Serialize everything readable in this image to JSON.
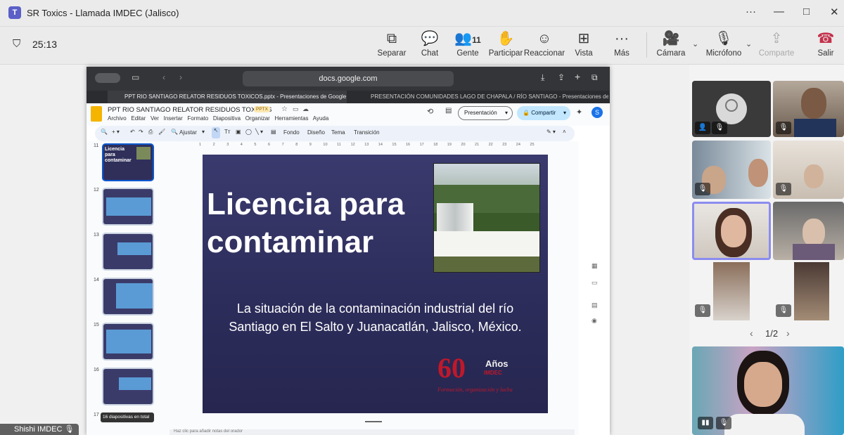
{
  "window": {
    "title": "SR Toxics - Llamada IMDEC (Jalisco)",
    "minimize": "—",
    "maximize": "□",
    "close": "✕",
    "more": "···"
  },
  "meeting": {
    "timer": "25:13"
  },
  "toolbar": [
    {
      "label": "Separar",
      "icon": "⧉"
    },
    {
      "label": "Chat",
      "icon": "💬"
    },
    {
      "label": "Gente",
      "icon": "👥",
      "badge": "11"
    },
    {
      "label": "Participar",
      "icon": "✋"
    },
    {
      "label": "Reaccionar",
      "icon": "☺"
    },
    {
      "label": "Vista",
      "icon": "⊞"
    },
    {
      "label": "Más",
      "icon": "···"
    },
    {
      "label": "Cámara",
      "icon": "🎥"
    },
    {
      "label": "Micrófono",
      "icon": "🎙"
    },
    {
      "label": "Comparte",
      "icon": "⇪"
    },
    {
      "label": "Salir",
      "icon": "☎"
    }
  ],
  "browser": {
    "url": "docs.google.com",
    "tabs": [
      "PPT RIO SANTIAGO RELATOR RESIDUOS TOXICOS.pptx - Presentaciones de Google",
      "PRESENTACIÓN COMUNIDADES LAGO DE CHAPALA / RÍO SANTIAGO - Presentaciones de Google"
    ]
  },
  "slides_app": {
    "doc_title": "PPT RIO SANTIAGO RELATOR RESIDUOS TOXICOS",
    "badge": "PPTX",
    "menu": [
      "Archivo",
      "Editar",
      "Ver",
      "Insertar",
      "Formato",
      "Diapositiva",
      "Organizar",
      "Herramientas",
      "Ayuda"
    ],
    "present_label": "Presentación",
    "share_label": "Compartir",
    "avatar": "S",
    "tools": [
      "Ajustar",
      "Fondo",
      "Diseño",
      "Tema",
      "Transición"
    ],
    "thumb_numbers": [
      "11",
      "12",
      "13",
      "14",
      "15",
      "16",
      "17"
    ],
    "thumb_title": "Licencia para contaminar",
    "slide_count_tooltip": "16 diapositivas en total",
    "notes_placeholder": "Haz clic para añadir notas del orador",
    "ruler": [
      "1",
      "2",
      "3",
      "4",
      "5",
      "6",
      "7",
      "8",
      "9",
      "10",
      "11",
      "12",
      "13",
      "14",
      "15",
      "16",
      "17",
      "18",
      "19",
      "20",
      "21",
      "22",
      "23",
      "24",
      "25"
    ]
  },
  "slide": {
    "title_line1": "Licencia para",
    "title_line2": "contaminar",
    "subtitle_line1": "La situación de la contaminación industrial del río",
    "subtitle_line2": "Santiago en El Salto y Juanacatlán, Jalisco, México.",
    "logo_number": "60",
    "logo_word": "Años",
    "logo_org": "IMDEC",
    "logo_tagline": "Formación, organización y lucha"
  },
  "participants": {
    "pagination": "1/2",
    "presenter_name": "Shishi IMDEC",
    "colors": {
      "teams_purple": "#5b5fc7",
      "leave_red": "#c4314b",
      "speaking_border": "#8b8cf0"
    }
  }
}
